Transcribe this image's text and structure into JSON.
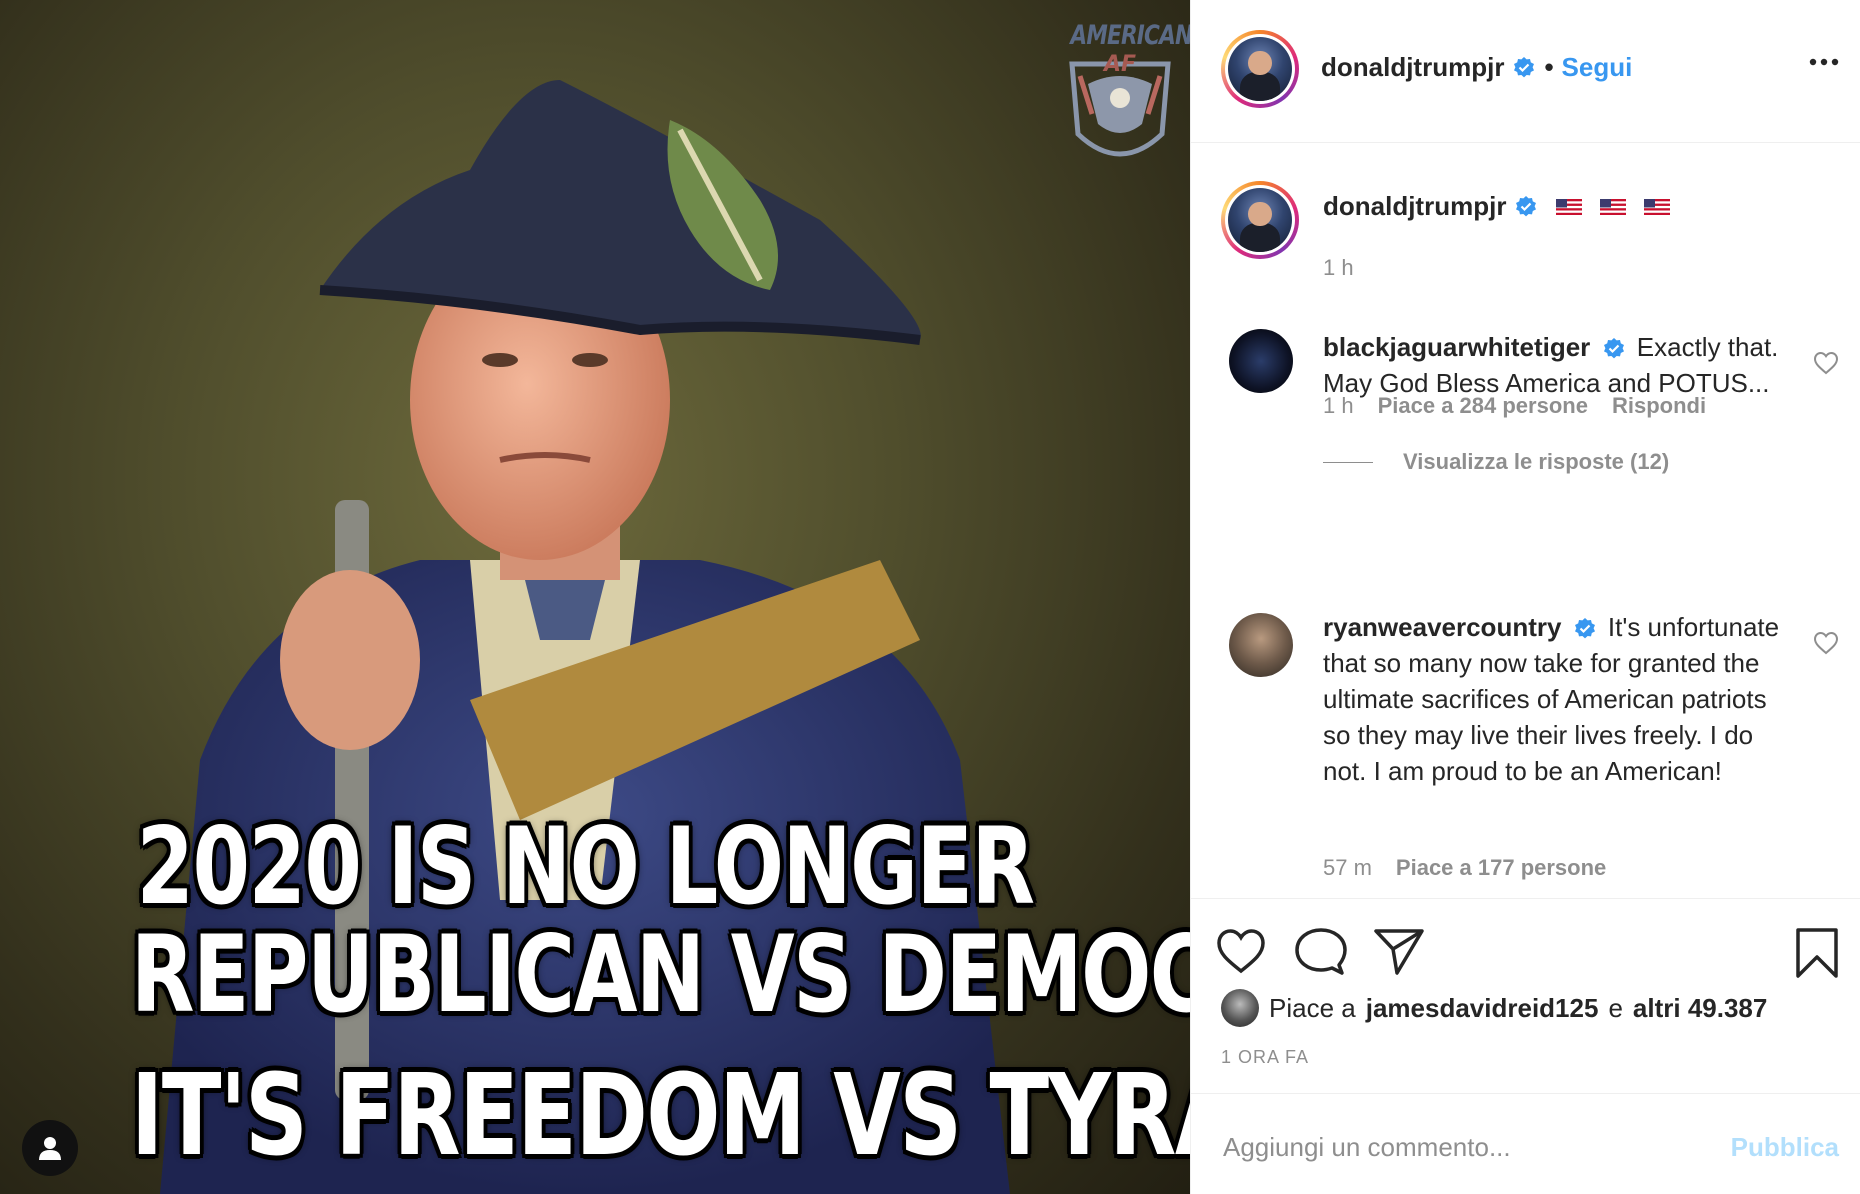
{
  "post_image": {
    "meme_line_1": "2020 IS NO LONGER",
    "meme_line_2": "REPUBLICAN VS DEMOCRAT",
    "meme_line_3": "IT'S FREEDOM VS TYRANNY",
    "watermark_text": "AMERICAN",
    "watermark_sub": "AF"
  },
  "header": {
    "username": "donaldjtrumpjr",
    "separator": "•",
    "follow_label": "Segui"
  },
  "caption": {
    "username": "donaldjtrumpjr",
    "time": "1 h"
  },
  "comments": [
    {
      "username": "blackjaguarwhitetiger",
      "text": "Exactly that. May God Bless America and POTUS...",
      "time": "1 h",
      "likes": "Piace a 284 persone",
      "reply": "Rispondi",
      "view_replies": "Visualizza le risposte (12)"
    },
    {
      "username": "ryanweavercountry",
      "text": "It's unfortunate that so many now take for granted the ultimate sacrifices of American patriots so they may live their lives freely. I do not. I am proud to be an American!",
      "time": "57 m",
      "likes": "Piace a 177 persone"
    }
  ],
  "likes_line": {
    "prefix": "Piace a",
    "user": "jamesdavidreid125",
    "middle": "e",
    "others": "altri 49.387"
  },
  "posted_ago": "1 ORA FA",
  "add_comment": {
    "placeholder": "Aggiungi un commento...",
    "publish_label": "Pubblica"
  },
  "colors": {
    "link_blue": "#3897f0",
    "publish_disabled": "#b2dffc",
    "muted_text": "#8e8e8e",
    "verified_blue": "#3897f0"
  },
  "icons": [
    "user-tag-icon",
    "verified-badge-icon",
    "more-options-icon",
    "heart-icon",
    "comment-icon",
    "share-icon",
    "bookmark-icon",
    "us-flag-icon"
  ]
}
